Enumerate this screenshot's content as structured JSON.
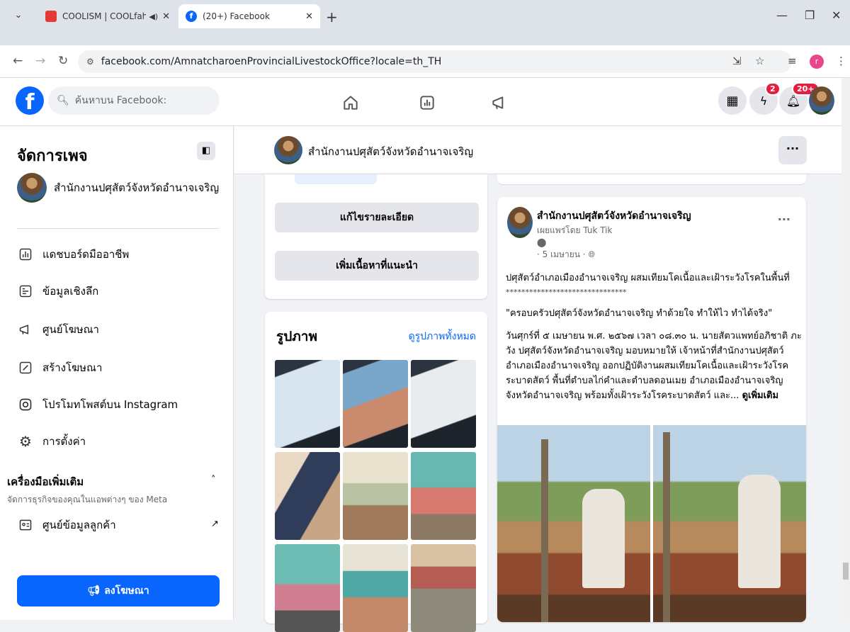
{
  "browser": {
    "tabs": [
      {
        "title": "COOLISM | COOLfahrenheit",
        "active": false,
        "favicon_color": "#e53935"
      },
      {
        "title": "(20+) Facebook",
        "active": true,
        "favicon_color": "#0866ff"
      }
    ],
    "url": "facebook.com/AmnatcharoenProvincialLivestockOffice?locale=th_TH",
    "profile_initial": "r"
  },
  "fb": {
    "search_placeholder": "ค้นหาบน Facebook:",
    "messenger_badge": "2",
    "notif_badge": "20+"
  },
  "sidebar": {
    "title": "จัดการเพจ",
    "page_name": "สำนักงานปศุสัตว์จังหวัดอำนาจเจริญ",
    "items": [
      {
        "label": "แดชบอร์ดมืออาชีพ",
        "icon": "dashboard-icon"
      },
      {
        "label": "ข้อมูลเชิงลึก",
        "icon": "insights-icon"
      },
      {
        "label": "ศูนย์โฆษณา",
        "icon": "megaphone-icon"
      },
      {
        "label": "สร้างโฆษณา",
        "icon": "pencil-icon"
      },
      {
        "label": "โปรโมทโพสต์บน Instagram",
        "icon": "instagram-icon"
      },
      {
        "label": "การตั้งค่า",
        "icon": "gear-icon"
      }
    ],
    "more_tools_title": "เครื่องมือเพิ่มเติม",
    "more_tools_sub": "จัดการธุรกิจของคุณในแอพต่างๆ ของ Meta",
    "crm_label": "ศูนย์ข้อมูลลูกค้า",
    "ad_button": "ลงโฆษณา"
  },
  "pagebar": {
    "name": "สำนักงานปศุสัตว์จังหวัดอำนาจเจริญ"
  },
  "left_col": {
    "edit_button": "แก้ไขรายละเอียด",
    "add_button": "เพิ่มเนื้อหาที่แนะนำ",
    "photos_title": "รูปภาพ",
    "photos_link": "ดูรูปภาพทั้งหมด"
  },
  "post": {
    "author": "สำนักงานปศุสัตว์จังหวัดอำนาจเจริญ",
    "published_by": "เผยแพร่โดย Tuk Tik",
    "date": "· 5 เมษายน ·",
    "line1": "ปศุสัตว์อำเภอเมืองอำนาจเจริญ ผสมเทียมโคเนื้อและเฝ้าระวังโรคในพื้นที่",
    "line2": "*******************************",
    "quote": "\"ครอบครัวปศุสัตว์จังหวัดอำนาจเจริญ ทำด้วยใจ ทำให้ไว ทำได้จริง\"",
    "body": "วันศุกร์ที่ ๕ เมษายน พ.ศ. ๒๕๖๗ เวลา ๐๘.๓๐ น. นายสัตวแพทย์อภิชาติ ภะวัง ปศุสัตว์จังหวัดอำนาจเจริญ มอบหมายให้ เจ้าหน้าที่สำนักงานปศุสัตว์อำเภอเมืองอำนาจเจริญ ออกปฏิบัติงานผสมเทียมโคเนื้อและเฝ้าระวังโรคระบาดสัตว์ พื้นที่ตำบลไก่คำและตำบลดอนเมย อำเภอเมืองอำนาจเจริญ จังหวัดอำนาจเจริญ พร้อมทั้งเฝ้าระวังโรคระบาดสัตว์ และ...",
    "see_more": "ดูเพิ่มเติม"
  }
}
